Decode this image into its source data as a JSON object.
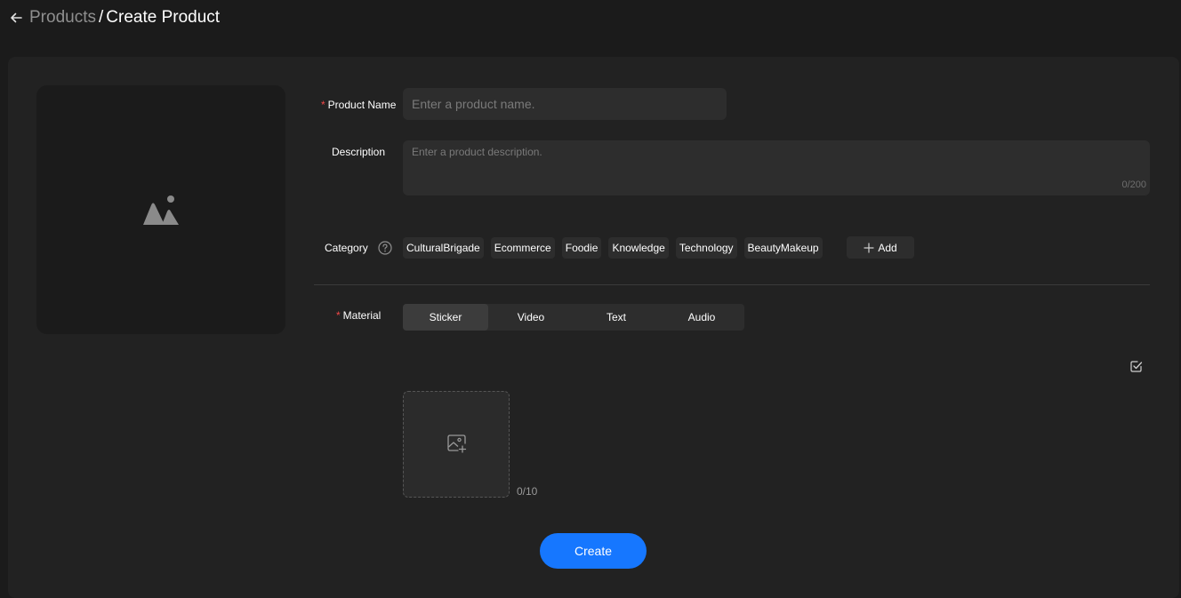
{
  "header": {
    "back_icon": "arrow-left-icon",
    "breadcrumb": {
      "parent": "Products",
      "separator": "/",
      "current": "Create Product"
    }
  },
  "cover": {
    "icon": "image-placeholder-icon"
  },
  "form": {
    "product_name": {
      "label": "Product Name",
      "required": true,
      "required_mark": "*",
      "value": "",
      "placeholder": "Enter a product name."
    },
    "description": {
      "label": "Description",
      "value": "",
      "placeholder": "Enter a product description.",
      "counter": "0/200"
    },
    "category": {
      "label": "Category",
      "help_icon": "question-circle-icon",
      "tags": [
        "CulturalBrigade",
        "Ecommerce",
        "Foodie",
        "Knowledge",
        "Technology",
        "BeautyMakeup"
      ],
      "add_label": "Add",
      "add_icon": "plus-icon"
    },
    "material": {
      "label": "Material",
      "required": true,
      "required_mark": "*",
      "tabs": [
        "Sticker",
        "Video",
        "Text",
        "Audio"
      ],
      "active_tab": "Sticker",
      "select_icon": "checkbox-select-icon",
      "upload_icon": "image-add-icon",
      "upload_counter": "0/10"
    }
  },
  "actions": {
    "create_label": "Create"
  },
  "colors": {
    "background": "#1b1b1b",
    "card": "#222222",
    "input": "#2d2d2d",
    "accent": "#1677ff",
    "required": "#f24848"
  }
}
